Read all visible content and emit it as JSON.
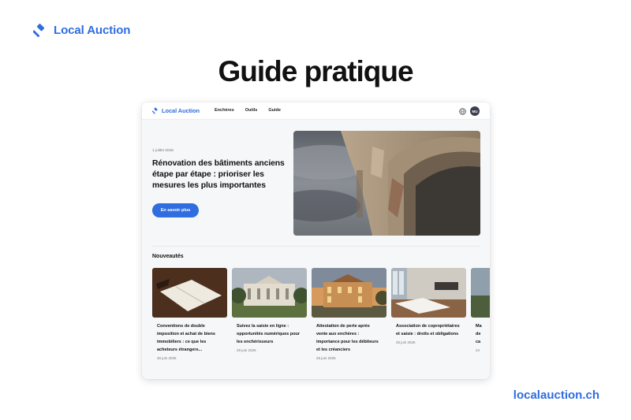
{
  "brand": {
    "name": "Local Auction",
    "icon": "gavel-icon",
    "color": "#2f6de0"
  },
  "headline": "Guide pratique",
  "footer_url": "localauction.ch",
  "app": {
    "brand": "Local Auction",
    "nav": [
      "Enchères",
      "Outils",
      "Guide"
    ],
    "avatar_initials": "MU",
    "hero": {
      "date": "1 juillet 2026",
      "title": "Rénovation des bâtiments anciens étape par étape : prioriser les mesures les plus importantes",
      "button": "En savoir plus"
    },
    "section_title": "Nouveautés",
    "cards": [
      {
        "title": "Conventions de double imposition et achat de biens immobiliers : ce que les acheteurs étrangers...",
        "date": "30 juin 2026",
        "image": "open-book-on-desk"
      },
      {
        "title": "Suivez la saisie en ligne : opportunités numériques pour les enchérisseurs",
        "date": "29 juin 2026",
        "image": "courthouse-building"
      },
      {
        "title": "Attestation de perte après vente aux enchères : importance pour les débiteurs et les créanciers",
        "date": "26 juin 2026",
        "image": "historic-building-sunset"
      },
      {
        "title": "Association de copropriétaires et saisie : droits et obligations",
        "date": "25 juin 2026",
        "image": "modern-apartment-interior"
      },
      {
        "title": "Ma\nde\nca",
        "date": "24",
        "image": "partial-card"
      }
    ]
  }
}
